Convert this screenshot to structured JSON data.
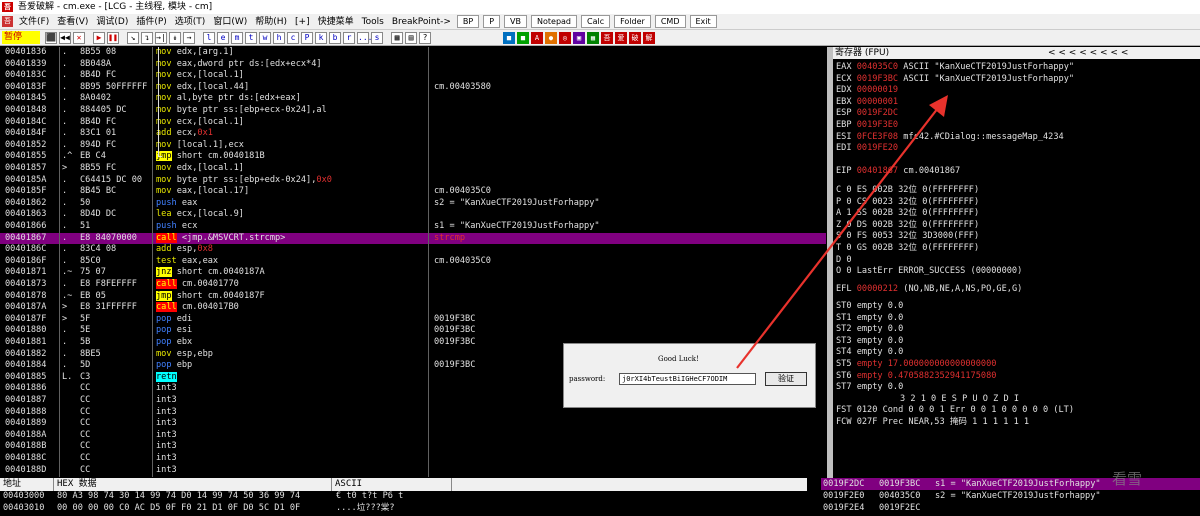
{
  "window": {
    "title": "吾爱破解 - cm.exe - [LCG - 主线程, 模块 - cm]",
    "icon_label": "吾"
  },
  "menu": {
    "items": [
      "文件(F)",
      "查看(V)",
      "调试(D)",
      "插件(P)",
      "选项(T)",
      "窗口(W)",
      "帮助(H)",
      "[+]",
      "快捷菜单",
      "Tools",
      "BreakPoint->"
    ],
    "plugin_buttons": [
      "BP",
      "P",
      "VB",
      "Notepad",
      "Calc",
      "Folder",
      "CMD",
      "Exit"
    ]
  },
  "toolbar": {
    "status": "暂停",
    "buttons": [
      "⬛",
      "◀◀",
      "✕",
      "▶",
      "❚❚",
      "↘",
      "↴",
      "→|",
      "↡",
      "→"
    ],
    "letters": [
      "l",
      "e",
      "m",
      "t",
      "w",
      "h",
      "c",
      "P",
      "k",
      "b",
      "r",
      "...",
      "s"
    ],
    "chinese_tools": [
      "吾",
      "爱",
      "破",
      "解"
    ]
  },
  "cpu": {
    "rows": [
      {
        "addr": "00401836",
        "mark": ".",
        "hex": "8B55 08",
        "asm": [
          {
            "t": "mov",
            "c": "mn"
          },
          {
            "t": " edx,[arg.1]"
          }
        ],
        "cmt": ""
      },
      {
        "addr": "00401839",
        "mark": ".",
        "hex": "8B048A",
        "asm": [
          {
            "t": "mov",
            "c": "mn"
          },
          {
            "t": " eax,dword ptr ds:[edx+ecx*4]"
          }
        ],
        "cmt": ""
      },
      {
        "addr": "0040183C",
        "mark": ".",
        "hex": "8B4D FC",
        "asm": [
          {
            "t": "mov",
            "c": "mn"
          },
          {
            "t": " ecx,[local.1]"
          }
        ],
        "cmt": ""
      },
      {
        "addr": "0040183F",
        "mark": ".",
        "hex": "8B95 50FFFFFF",
        "asm": [
          {
            "t": "mov",
            "c": "mn"
          },
          {
            "t": " edx,[local.44]"
          }
        ],
        "cmt": "cm.00403580"
      },
      {
        "addr": "00401845",
        "mark": ".",
        "hex": "8A0402",
        "asm": [
          {
            "t": "mov",
            "c": "mn"
          },
          {
            "t": " al,byte ptr ds:[edx+eax]"
          }
        ],
        "cmt": ""
      },
      {
        "addr": "00401848",
        "mark": ".",
        "hex": "884405 DC",
        "asm": [
          {
            "t": "mov",
            "c": "mn"
          },
          {
            "t": " byte ptr ss:[ebp+ecx-0x24],al"
          }
        ],
        "cmt": ""
      },
      {
        "addr": "0040184C",
        "mark": ".",
        "hex": "8B4D FC",
        "asm": [
          {
            "t": "mov",
            "c": "mn"
          },
          {
            "t": " ecx,[local.1]"
          }
        ],
        "cmt": ""
      },
      {
        "addr": "0040184F",
        "mark": ".",
        "hex": "83C1 01",
        "asm": [
          {
            "t": "add",
            "c": "mn"
          },
          {
            "t": " ecx,"
          },
          {
            "t": "0x1",
            "c": "imm"
          }
        ],
        "cmt": ""
      },
      {
        "addr": "00401852",
        "mark": ".",
        "hex": "894D FC",
        "asm": [
          {
            "t": "mov",
            "c": "mn"
          },
          {
            "t": " [local.1],ecx"
          }
        ],
        "cmt": ""
      },
      {
        "addr": "00401855",
        "mark": ".^",
        "hex": "EB C4",
        "asm": [
          {
            "t": "jmp",
            "c": "mn-jmp"
          },
          {
            "t": " short cm.0040181B"
          }
        ],
        "cmt": ""
      },
      {
        "addr": "00401857",
        "mark": ">",
        "hex": "8B55 FC",
        "asm": [
          {
            "t": "mov",
            "c": "mn"
          },
          {
            "t": " edx,[local.1]"
          }
        ],
        "cmt": ""
      },
      {
        "addr": "0040185A",
        "mark": ".",
        "hex": "C64415 DC 00",
        "asm": [
          {
            "t": "mov",
            "c": "mn"
          },
          {
            "t": " byte ptr ss:[ebp+edx-0x24],"
          },
          {
            "t": "0x0",
            "c": "imm"
          }
        ],
        "cmt": ""
      },
      {
        "addr": "0040185F",
        "mark": ".",
        "hex": "8B45 BC",
        "asm": [
          {
            "t": "mov",
            "c": "mn"
          },
          {
            "t": " eax,[local.17]"
          }
        ],
        "cmt": "cm.004035C0"
      },
      {
        "addr": "00401862",
        "mark": ".",
        "hex": "50",
        "asm": [
          {
            "t": "push",
            "c": "mn-push"
          },
          {
            "t": " eax"
          }
        ],
        "cmt": "s2 = \"KanXueCTF2019JustForhappy\""
      },
      {
        "addr": "00401863",
        "mark": ".",
        "hex": "8D4D DC",
        "asm": [
          {
            "t": "lea",
            "c": "mn"
          },
          {
            "t": " ecx,[local.9]"
          }
        ],
        "cmt": ""
      },
      {
        "addr": "00401866",
        "mark": ".",
        "hex": "51",
        "asm": [
          {
            "t": "push",
            "c": "mn-push"
          },
          {
            "t": " ecx"
          }
        ],
        "cmt": "s1 = \"KanXueCTF2019JustForhappy\""
      },
      {
        "addr": "00401867",
        "mark": ".",
        "hex": "E8 84070000",
        "asm": [
          {
            "t": "call",
            "c": "mn-call"
          },
          {
            "t": " <jmp.&MSVCRT.strcmp>"
          }
        ],
        "cmt": "strcmp",
        "sel": true
      },
      {
        "addr": "0040186C",
        "mark": ".",
        "hex": "83C4 08",
        "asm": [
          {
            "t": "add",
            "c": "mn"
          },
          {
            "t": " esp,"
          },
          {
            "t": "0x8",
            "c": "imm"
          }
        ],
        "cmt": ""
      },
      {
        "addr": "0040186F",
        "mark": ".",
        "hex": "85C0",
        "asm": [
          {
            "t": "test",
            "c": "mn"
          },
          {
            "t": " eax,eax"
          }
        ],
        "cmt": "cm.004035C0"
      },
      {
        "addr": "00401871",
        "mark": ".~",
        "hex": "75 07",
        "asm": [
          {
            "t": "jnz",
            "c": "mn-jmp"
          },
          {
            "t": " short cm.0040187A"
          }
        ],
        "cmt": ""
      },
      {
        "addr": "00401873",
        "mark": ".",
        "hex": "E8 F8FEFFFF",
        "asm": [
          {
            "t": "call",
            "c": "mn-call"
          },
          {
            "t": " cm.00401770"
          }
        ],
        "cmt": ""
      },
      {
        "addr": "00401878",
        "mark": ".~",
        "hex": "EB 05",
        "asm": [
          {
            "t": "jmp",
            "c": "mn-jmp"
          },
          {
            "t": " short cm.0040187F"
          }
        ],
        "cmt": ""
      },
      {
        "addr": "0040187A",
        "mark": ">",
        "hex": "E8 31FFFFFF",
        "asm": [
          {
            "t": "call",
            "c": "mn-call"
          },
          {
            "t": " cm.004017B0"
          }
        ],
        "cmt": ""
      },
      {
        "addr": "0040187F",
        "mark": ">",
        "hex": "5F",
        "asm": [
          {
            "t": "pop",
            "c": "mn-push"
          },
          {
            "t": " edi"
          }
        ],
        "cmt": "0019F3BC"
      },
      {
        "addr": "00401880",
        "mark": ".",
        "hex": "5E",
        "asm": [
          {
            "t": "pop",
            "c": "mn-push"
          },
          {
            "t": " esi"
          }
        ],
        "cmt": "0019F3BC"
      },
      {
        "addr": "00401881",
        "mark": ".",
        "hex": "5B",
        "asm": [
          {
            "t": "pop",
            "c": "mn-push"
          },
          {
            "t": " ebx"
          }
        ],
        "cmt": "0019F3BC"
      },
      {
        "addr": "00401882",
        "mark": ".",
        "hex": "8BE5",
        "asm": [
          {
            "t": "mov",
            "c": "mn"
          },
          {
            "t": " esp,ebp"
          }
        ],
        "cmt": ""
      },
      {
        "addr": "00401884",
        "mark": ".",
        "hex": "5D",
        "asm": [
          {
            "t": "pop",
            "c": "mn-push"
          },
          {
            "t": " ebp"
          }
        ],
        "cmt": "0019F3BC"
      },
      {
        "addr": "00401885",
        "mark": "L.",
        "hex": "C3",
        "asm": [
          {
            "t": "retn",
            "c": "mn-retn"
          }
        ],
        "cmt": ""
      },
      {
        "addr": "00401886",
        "mark": "",
        "hex": "CC",
        "asm": [
          {
            "t": "int3"
          }
        ],
        "cmt": ""
      },
      {
        "addr": "00401887",
        "mark": "",
        "hex": "CC",
        "asm": [
          {
            "t": "int3"
          }
        ],
        "cmt": ""
      },
      {
        "addr": "00401888",
        "mark": "",
        "hex": "CC",
        "asm": [
          {
            "t": "int3"
          }
        ],
        "cmt": ""
      },
      {
        "addr": "00401889",
        "mark": "",
        "hex": "CC",
        "asm": [
          {
            "t": "int3"
          }
        ],
        "cmt": ""
      },
      {
        "addr": "0040188A",
        "mark": "",
        "hex": "CC",
        "asm": [
          {
            "t": "int3"
          }
        ],
        "cmt": ""
      },
      {
        "addr": "0040188B",
        "mark": "",
        "hex": "CC",
        "asm": [
          {
            "t": "int3"
          }
        ],
        "cmt": ""
      },
      {
        "addr": "0040188C",
        "mark": "",
        "hex": "CC",
        "asm": [
          {
            "t": "int3"
          }
        ],
        "cmt": ""
      },
      {
        "addr": "0040188D",
        "mark": "",
        "hex": "CC",
        "asm": [
          {
            "t": "int3"
          }
        ],
        "cmt": ""
      }
    ]
  },
  "registers": {
    "header": "寄存器 (FPU)",
    "arrows": "<   <   <   <   <   <   <   <",
    "gp": [
      {
        "name": "EAX",
        "val": "004035C0",
        "rest": " ASCII \"KanXueCTF2019JustForhappy\"",
        "red": true
      },
      {
        "name": "ECX",
        "val": "0019F3BC",
        "rest": " ASCII \"KanXueCTF2019JustForhappy\"",
        "red": true
      },
      {
        "name": "EDX",
        "val": "00000019",
        "rest": "",
        "red": true
      },
      {
        "name": "EBX",
        "val": "00000001",
        "rest": "",
        "red": true
      },
      {
        "name": "ESP",
        "val": "0019F2DC",
        "rest": "",
        "red": true
      },
      {
        "name": "EBP",
        "val": "0019F3E0",
        "rest": "",
        "red": true
      },
      {
        "name": "ESI",
        "val": "0FCE3F08",
        "rest": " mfc42.#CDialog::messageMap_4234",
        "red": true
      },
      {
        "name": "EDI",
        "val": "0019FE20",
        "rest": "",
        "red": true
      }
    ],
    "eip": {
      "name": "EIP",
      "val": "00401867",
      "rest": " cm.00401867"
    },
    "flags": [
      "C 0  ES 002B 32位 0(FFFFFFFF)",
      "P 0  CS 0023 32位 0(FFFFFFFF)",
      "A 1  SS 002B 32位 0(FFFFFFFF)",
      "Z 0  DS 002B 32位 0(FFFFFFFF)",
      "S 0  FS 0053 32位 3D3000(FFF)",
      "T 0  GS 002B 32位 0(FFFFFFFF)",
      "D 0",
      "O 0  LastErr ERROR_SUCCESS (00000000)"
    ],
    "efl": {
      "name": "EFL",
      "val": "00000212",
      "rest": " (NO,NB,NE,A,NS,PO,GE,G)"
    },
    "st": [
      {
        "name": "ST0",
        "val": "empty 0.0",
        "red": false
      },
      {
        "name": "ST1",
        "val": "empty 0.0",
        "red": false
      },
      {
        "name": "ST2",
        "val": "empty 0.0",
        "red": false
      },
      {
        "name": "ST3",
        "val": "empty 0.0",
        "red": false
      },
      {
        "name": "ST4",
        "val": "empty 0.0",
        "red": false
      },
      {
        "name": "ST5",
        "val": "empty 17.000000000000000000",
        "red": true
      },
      {
        "name": "ST6",
        "val": "empty 0.4705882352941175080",
        "red": true
      },
      {
        "name": "ST7",
        "val": "empty 0.0",
        "red": false
      }
    ],
    "fpu_bits_header": "3 2 1 0      E S P U O Z D I",
    "fst": "FST 0120  Cond 0 0 0 1  Err 0 0 1 0 0 0 0 0  (LT)",
    "fcw": "FCW 027F  Prec NEAR,53  掩码    1 1 1 1 1 1"
  },
  "dump": {
    "headers": [
      "地址",
      "HEX 数据",
      "ASCII"
    ],
    "rows": [
      {
        "addr": "00403000",
        "hex": "80 A3 98 74 30 14 99 74 D0 14 99 74 50 36 99 74",
        "ascii": "€  t0 t?t P6 t"
      },
      {
        "addr": "00403010",
        "hex": "00 00 00 00 C0 AC D5 0F F0 21 D1 0F D0 5C D1 0F",
        "ascii": "....垃???棠?"
      }
    ]
  },
  "stack": {
    "rows": [
      {
        "addr": "0019F2DC",
        "val": "0019F3BC",
        "cmt": "s1 = \"KanXueCTF2019JustForhappy\"",
        "sel": true
      },
      {
        "addr": "0019F2E0",
        "val": "004035C0",
        "cmt": "s2 = \"KanXueCTF2019JustForhappy\"",
        "sel": false
      },
      {
        "addr": "0019F2E4",
        "val": "0019F2EC",
        "cmt": "",
        "sel": false
      }
    ]
  },
  "dialog": {
    "title": "Good Luck!",
    "label": "password:",
    "value": "j0rXI4bTeustBiIGHeCF7ODIM",
    "button": "验证"
  },
  "watermark": "看雪",
  "colors": {
    "selection": "#800080",
    "arrow": "#e8322c",
    "mnemonic": "#e8e800",
    "call_bg": "#ff0000"
  }
}
